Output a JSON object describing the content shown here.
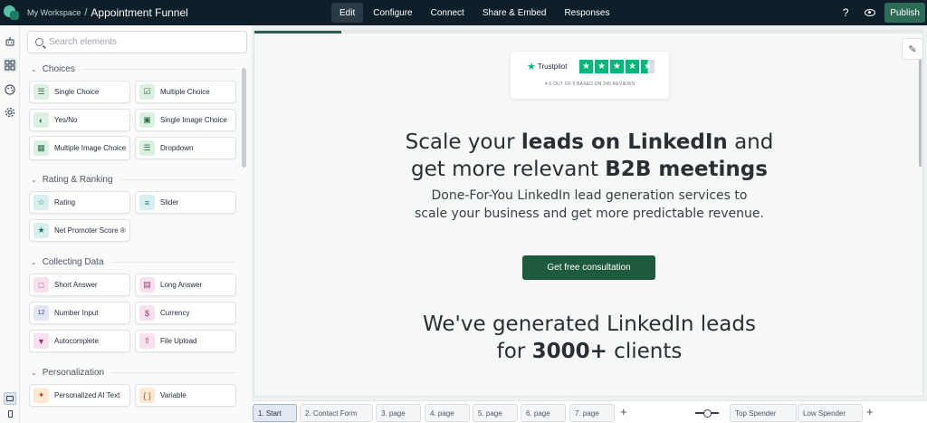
{
  "topbar": {
    "workspace": "My Workspace",
    "separator": "/",
    "form_title": "Appointment Funnel",
    "tabs": [
      {
        "label": "Edit",
        "active": true
      },
      {
        "label": "Configure",
        "active": false
      },
      {
        "label": "Connect",
        "active": false
      },
      {
        "label": "Share & Embed",
        "active": false
      },
      {
        "label": "Responses",
        "active": false
      }
    ],
    "help": "?",
    "publish_label": "Publish"
  },
  "rail": {
    "icons": [
      "robot-icon",
      "elements-icon",
      "palette-icon",
      "settings-icon"
    ],
    "devices": [
      "desktop-icon",
      "mobile-icon"
    ]
  },
  "elements_panel": {
    "search_placeholder": "Search elements",
    "sections": [
      {
        "title": "Choices",
        "items": [
          {
            "label": "Single Choice",
            "icon": "single-choice-icon",
            "color": "green"
          },
          {
            "label": "Multiple Choice",
            "icon": "multiple-choice-icon",
            "color": "green"
          },
          {
            "label": "Yes/No",
            "icon": "yes-no-icon",
            "color": "green"
          },
          {
            "label": "Single Image Choice",
            "icon": "image-choice-icon",
            "color": "green"
          },
          {
            "label": "Multiple Image Choice",
            "icon": "multi-image-choice-icon",
            "color": "green"
          },
          {
            "label": "Dropdown",
            "icon": "dropdown-icon",
            "color": "green"
          }
        ]
      },
      {
        "title": "Rating & Ranking",
        "items": [
          {
            "label": "Rating",
            "icon": "star-icon",
            "color": "teal"
          },
          {
            "label": "Slider",
            "icon": "slider-icon",
            "color": "teal"
          },
          {
            "label": "Net Promoter Score ®",
            "icon": "nps-icon",
            "color": "teal"
          }
        ]
      },
      {
        "title": "Collecting Data",
        "items": [
          {
            "label": "Short Answer",
            "icon": "short-answer-icon",
            "color": "pink"
          },
          {
            "label": "Long Answer",
            "icon": "long-answer-icon",
            "color": "pink"
          },
          {
            "label": "Number Input",
            "icon": "number-icon",
            "color": "blue"
          },
          {
            "label": "Currency",
            "icon": "currency-icon",
            "color": "pink"
          },
          {
            "label": "Autocomplete",
            "icon": "autocomplete-icon",
            "color": "pink"
          },
          {
            "label": "File Upload",
            "icon": "file-upload-icon",
            "color": "pink"
          }
        ]
      },
      {
        "title": "Personalization",
        "items": [
          {
            "label": "Personalized AI Text",
            "icon": "ai-text-icon",
            "color": "orange"
          },
          {
            "label": "Variable",
            "icon": "variable-icon",
            "color": "orange"
          }
        ]
      }
    ]
  },
  "canvas": {
    "progress": 0.13,
    "trustpilot": {
      "brand": "Trustpilot",
      "stars": 4.5,
      "subtitle": "4.6 OUT OF 5 BASED ON 245 REVIEWS"
    },
    "headline_line1_pre": "Scale your ",
    "headline_line1_bold": "leads on LinkedIn",
    "headline_line1_post": " and",
    "headline_line2_pre": "get more relevant ",
    "headline_line2_bold": "B2B meetings",
    "subheadline_line1": "Done-For-You LinkedIn lead generation services to",
    "subheadline_line2": "scale your business and get more predictable revenue.",
    "cta_label": "Get free consultation",
    "headline2_line1": "We've generated LinkedIn leads",
    "headline2_line2_pre": "for ",
    "headline2_line2_bold": "3000+",
    "headline2_line2_post": " clients"
  },
  "pages": [
    {
      "label": "1. Start",
      "active": true
    },
    {
      "label": "2. Contact Form",
      "active": false
    },
    {
      "label": "3. page",
      "active": false
    },
    {
      "label": "4. page",
      "active": false
    },
    {
      "label": "5. page",
      "active": false
    },
    {
      "label": "6. page",
      "active": false
    },
    {
      "label": "7. page",
      "active": false
    }
  ],
  "endings": [
    {
      "label": "Top Spender"
    },
    {
      "label": "Low Spender"
    }
  ],
  "add_symbol": "+"
}
